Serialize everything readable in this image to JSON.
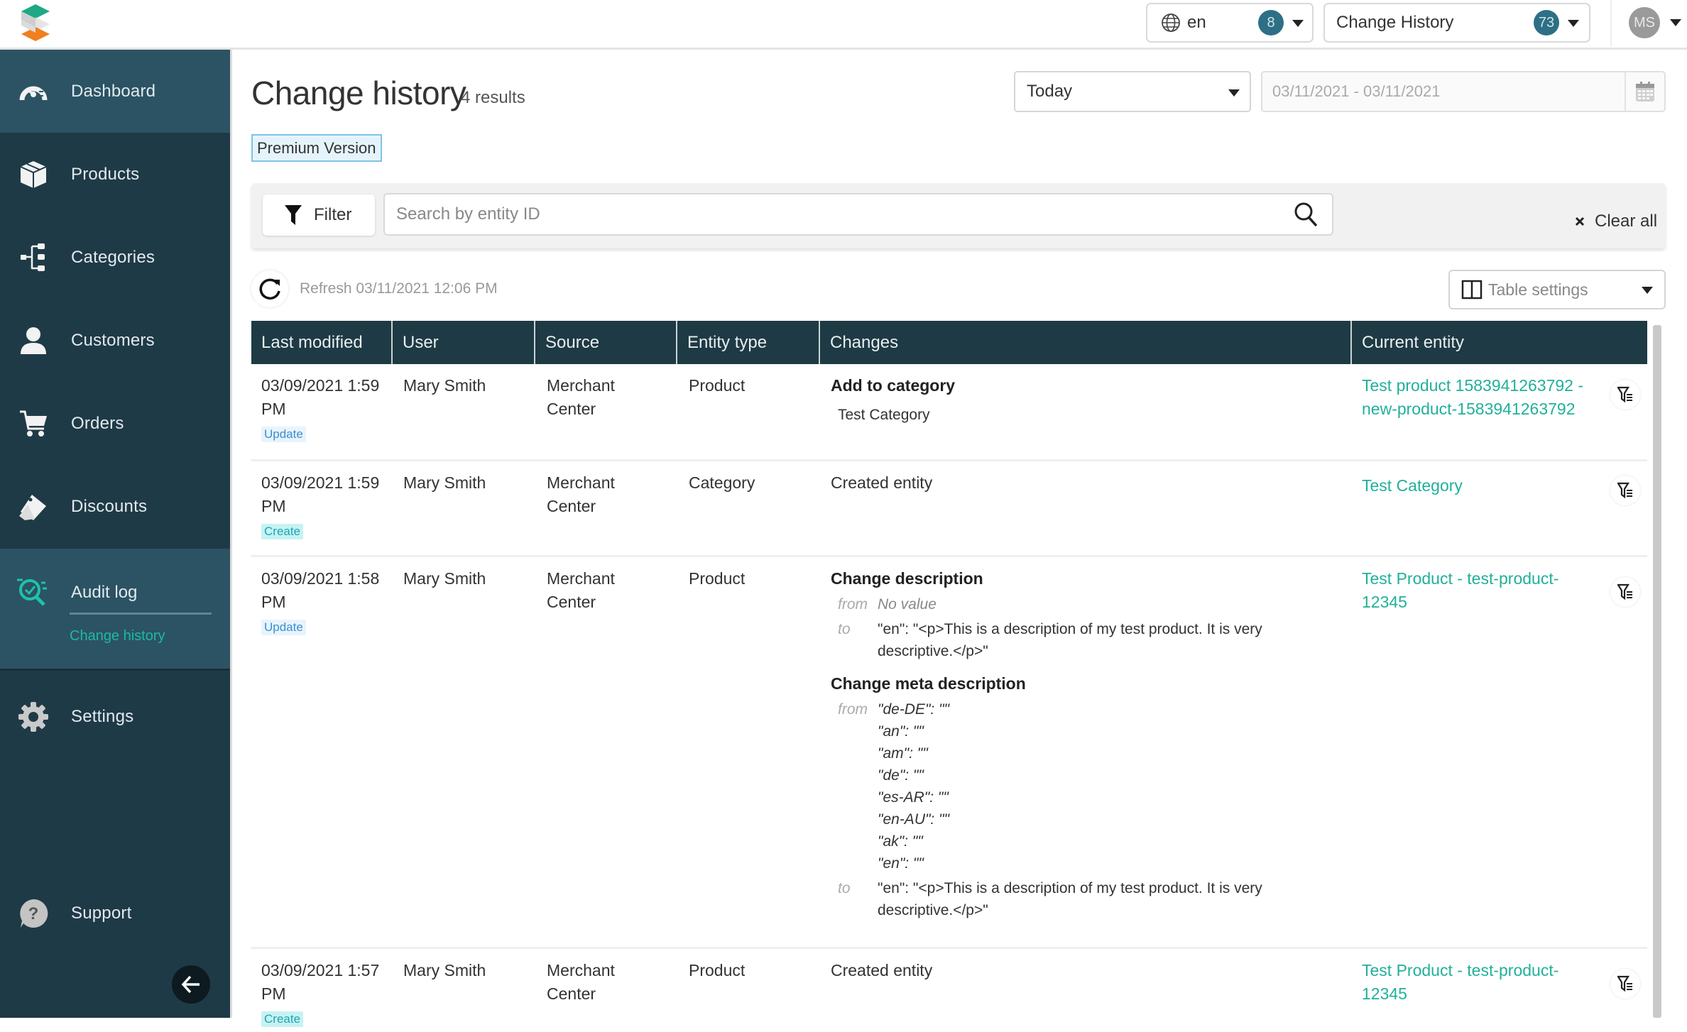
{
  "topbar": {
    "language": {
      "value": "en",
      "badge": "8",
      "icon": "globe-icon"
    },
    "view": {
      "value": "Change History",
      "badge": "73"
    },
    "user": {
      "initials": "MS"
    }
  },
  "sidebar": {
    "items": [
      {
        "id": "dashboard",
        "label": "Dashboard",
        "icon": "dashboard-gauge-icon"
      },
      {
        "id": "products",
        "label": "Products",
        "icon": "box-icon"
      },
      {
        "id": "categories",
        "label": "Categories",
        "icon": "hierarchy-icon"
      },
      {
        "id": "customers",
        "label": "Customers",
        "icon": "user-icon"
      },
      {
        "id": "orders",
        "label": "Orders",
        "icon": "cart-icon"
      },
      {
        "id": "discounts",
        "label": "Discounts",
        "icon": "tags-icon"
      },
      {
        "id": "audit-log",
        "label": "Audit log",
        "icon": "audit-search-icon",
        "active": true,
        "sub_items": [
          {
            "label": "Change history",
            "active": true
          }
        ]
      },
      {
        "id": "settings",
        "label": "Settings",
        "icon": "gear-icon"
      },
      {
        "id": "support",
        "label": "Support",
        "icon": "question-bubble-icon"
      }
    ],
    "collapse_icon": "arrow-left-icon"
  },
  "page": {
    "title": "Change history",
    "result_count": "4 results",
    "edition_badge": "Premium Version",
    "period": {
      "selected": "Today"
    },
    "date_range": {
      "value": "03/11/2021 - 03/11/2021"
    }
  },
  "filters": {
    "filter_label": "Filter",
    "search_placeholder": "Search by entity ID",
    "search_value": "",
    "clear_all_label": "Clear all"
  },
  "toolbar": {
    "refresh_text": "Refresh 03/11/2021 12:06 PM",
    "table_settings_label": "Table settings"
  },
  "table": {
    "columns": [
      "Last modified",
      "User",
      "Source",
      "Entity type",
      "Changes",
      "Current entity"
    ],
    "rows": [
      {
        "last_modified": "03/09/2021 1:59 PM",
        "action": "Update",
        "user": "Mary Smith",
        "source": "Merchant Center",
        "entity_type": "Product",
        "changes": {
          "title": "Add to category",
          "detail": "Test Category"
        },
        "current_entity": "Test product 1583941263792 - new-product-1583941263792"
      },
      {
        "last_modified": "03/09/2021 1:59 PM",
        "action": "Create",
        "user": "Mary Smith",
        "source": "Merchant Center",
        "entity_type": "Category",
        "changes": {
          "title": "Created entity"
        },
        "current_entity": "Test Category"
      },
      {
        "last_modified": "03/09/2021 1:58 PM",
        "action": "Update",
        "user": "Mary Smith",
        "source": "Merchant Center",
        "entity_type": "Product",
        "changes": {
          "blocks": [
            {
              "title": "Change description",
              "from_label": "from",
              "from": [
                "No value"
              ],
              "to_label": "to",
              "to": [
                "\"en\": \"<p>This is a description of my test product. It is very descriptive.</p>\""
              ]
            },
            {
              "title": "Change meta description",
              "from_label": "from",
              "from": [
                "\"de-DE\": \"\"",
                "\"an\": \"\"",
                "\"am\": \"\"",
                "\"de\": \"\"",
                "\"es-AR\": \"\"",
                "\"en-AU\": \"\"",
                "\"ak\": \"\"",
                "\"en\": \"\""
              ],
              "to_label": "to",
              "to": [
                "\"en\": \"<p>This is a description of my test product. It is very descriptive.</p>\""
              ]
            }
          ]
        },
        "current_entity": "Test Product - test-product-12345"
      },
      {
        "last_modified": "03/09/2021 1:57 PM",
        "action": "Create",
        "user": "Mary Smith",
        "source": "Merchant Center",
        "entity_type": "Product",
        "changes": {
          "title": "Created entity"
        },
        "current_entity": "Test Product - test-product-12345"
      }
    ]
  },
  "colors": {
    "sidebar_bg": "#1f3a47",
    "sidebar_active_bg": "#2b5364",
    "table_header_bg": "#1e3a44",
    "accent_teal": "#21b09a",
    "badge_blue": "#2d6f85"
  }
}
